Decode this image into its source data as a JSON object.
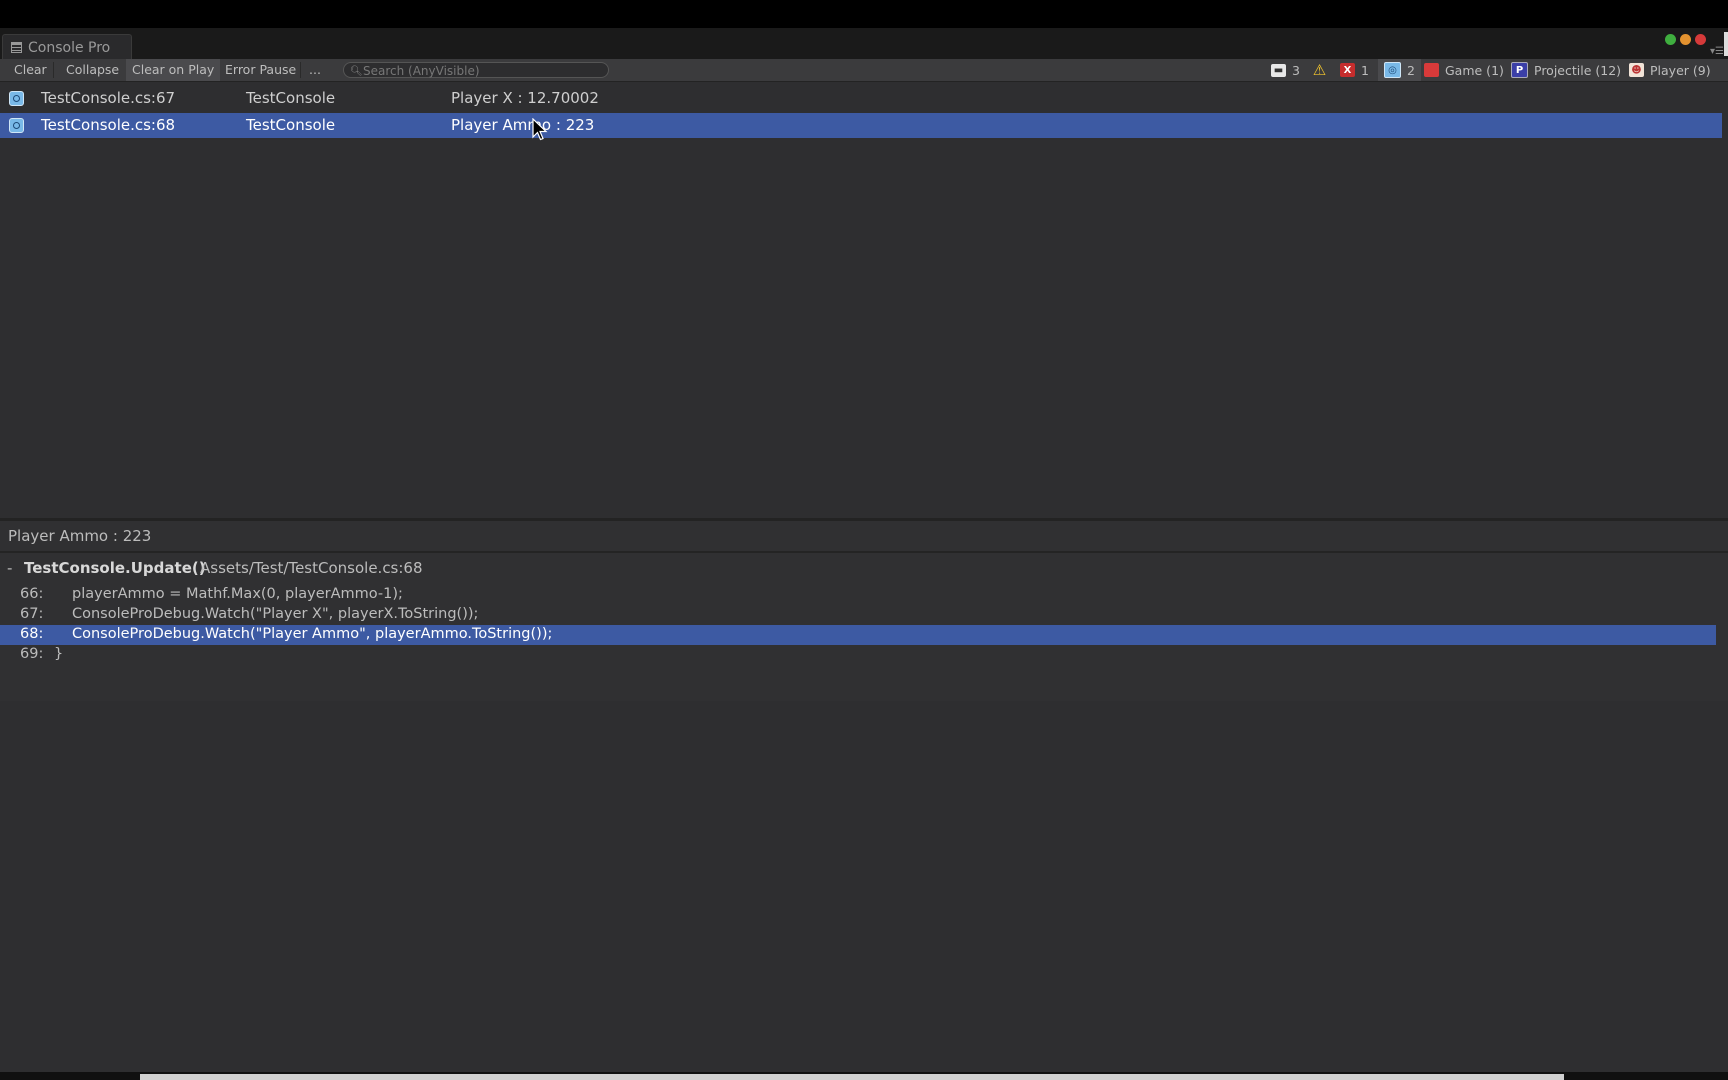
{
  "window": {
    "tab_title": "Console Pro",
    "traffic_lights": {
      "green": "#3fae3f",
      "orange": "#e3922f",
      "red": "#d63a3a"
    }
  },
  "toolbar": {
    "clear": "Clear",
    "collapse": "Collapse",
    "clear_on_play": "Clear on Play",
    "error_pause": "Error Pause",
    "more": "...",
    "search_placeholder": "Search (AnyVisible)"
  },
  "filters": [
    {
      "icon": "log-icon",
      "count": "3"
    },
    {
      "icon": "warning-icon",
      "count": ""
    },
    {
      "icon": "error-icon",
      "count": "1"
    },
    {
      "icon": "watch-icon",
      "count": "2"
    },
    {
      "icon": "game-icon",
      "label": "Game (1)"
    },
    {
      "icon": "projectile-icon",
      "label": "Projectile (12)"
    },
    {
      "icon": "player-icon",
      "label": "Player (9)"
    }
  ],
  "log_rows": [
    {
      "source": "TestConsole.cs:67",
      "class": "TestConsole",
      "message": "Player X : 12.70002"
    },
    {
      "source": "TestConsole.cs:68",
      "class": "TestConsole",
      "message": "Player Ammo : 223"
    }
  ],
  "detail": {
    "message": "Player Ammo : 223",
    "frame_toggle": "-",
    "function": "TestConsole.Update()",
    "path": "Assets/Test/TestConsole.cs:68",
    "code_lines": [
      {
        "ln": "66:",
        "code": "playerAmmo = Mathf.Max(0, playerAmmo-1);"
      },
      {
        "ln": "67:",
        "code": "ConsoleProDebug.Watch(\"Player X\", playerX.ToString());"
      },
      {
        "ln": "68:",
        "code": "ConsoleProDebug.Watch(\"Player Ammo\", playerAmmo.ToString());"
      },
      {
        "ln": "69:",
        "code": "}"
      }
    ]
  },
  "colors": {
    "selection": "#3d5aa3",
    "panel": "#2e2e30",
    "toolbar": "#3b3b3d"
  }
}
